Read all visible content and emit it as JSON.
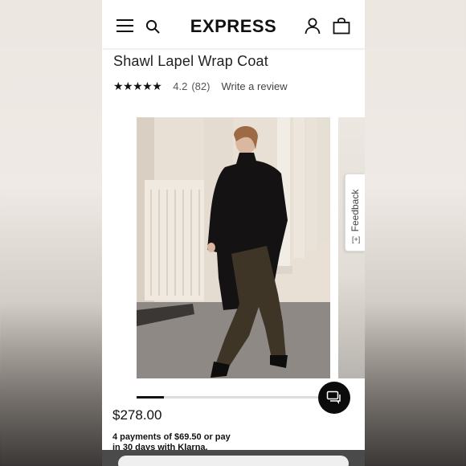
{
  "header": {
    "brand": "EXPRESS",
    "icons": [
      "menu-icon",
      "search-icon",
      "account-icon",
      "bag-icon"
    ]
  },
  "product": {
    "title": "Shawl Lapel Wrap Coat",
    "stars": "★★★★★",
    "rating": "4.2",
    "review_count": "(82)",
    "write_review": "Write a review",
    "price": "$278.00",
    "klarna_line1": "4 payments of $69.50 or pay",
    "klarna_line2": "in 30 days with Klarna."
  },
  "gallery": {
    "progress": 0.14
  },
  "feedback": {
    "label": "Feedback",
    "icon": "[+]"
  },
  "chat": {
    "icon": "chat-icon"
  },
  "colors": {
    "accent": "#111111",
    "chat_bg": "#0b0b0b"
  }
}
